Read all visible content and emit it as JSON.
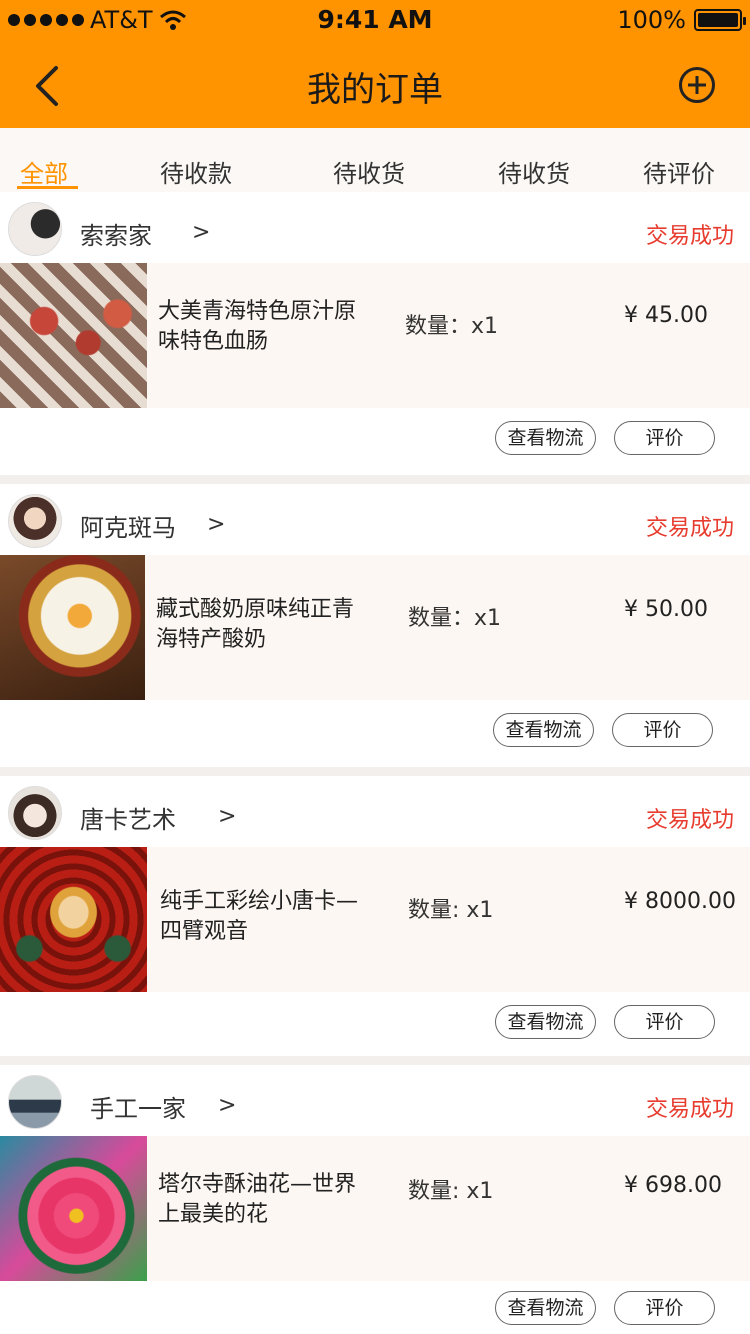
{
  "status_bar": {
    "carrier": "AT&T",
    "time": "9:41 AM",
    "battery": "100%"
  },
  "nav": {
    "title": "我的订单"
  },
  "tabs": [
    {
      "label": "全部",
      "active": true
    },
    {
      "label": "待收款",
      "active": false
    },
    {
      "label": "待收货",
      "active": false
    },
    {
      "label": "待收货",
      "active": false
    },
    {
      "label": "待评价",
      "active": false
    }
  ],
  "orders": [
    {
      "shop": "索索家",
      "arrow": ">",
      "status": "交易成功",
      "product": "大美青海特色原汁原味特色血肠",
      "qty": "数量：x1",
      "price": "¥  45.00",
      "logistics": "查看物流",
      "review": "评价"
    },
    {
      "shop": "阿克斑马",
      "arrow": ">",
      "status": "交易成功",
      "product": "藏式酸奶原味纯正青海特产酸奶",
      "qty": "数量：x1",
      "price": "¥  50.00",
      "logistics": "查看物流",
      "review": "评价"
    },
    {
      "shop": "唐卡艺术",
      "arrow": ">",
      "status": "交易成功",
      "product": "纯手工彩绘小唐卡—四臂观音",
      "qty": "数量: x1",
      "price": "¥  8000.00",
      "logistics": "查看物流",
      "review": "评价"
    },
    {
      "shop": "手工一家",
      "arrow": ">",
      "status": "交易成功",
      "product": "塔尔寺酥油花—世界上最美的花",
      "qty": "数量: x1",
      "price": "¥  698.00",
      "logistics": "查看物流",
      "review": "评价"
    }
  ],
  "colors": {
    "accent": "#ff9300",
    "status_red": "#e73b2e",
    "item_bg": "#fcf7f2"
  }
}
